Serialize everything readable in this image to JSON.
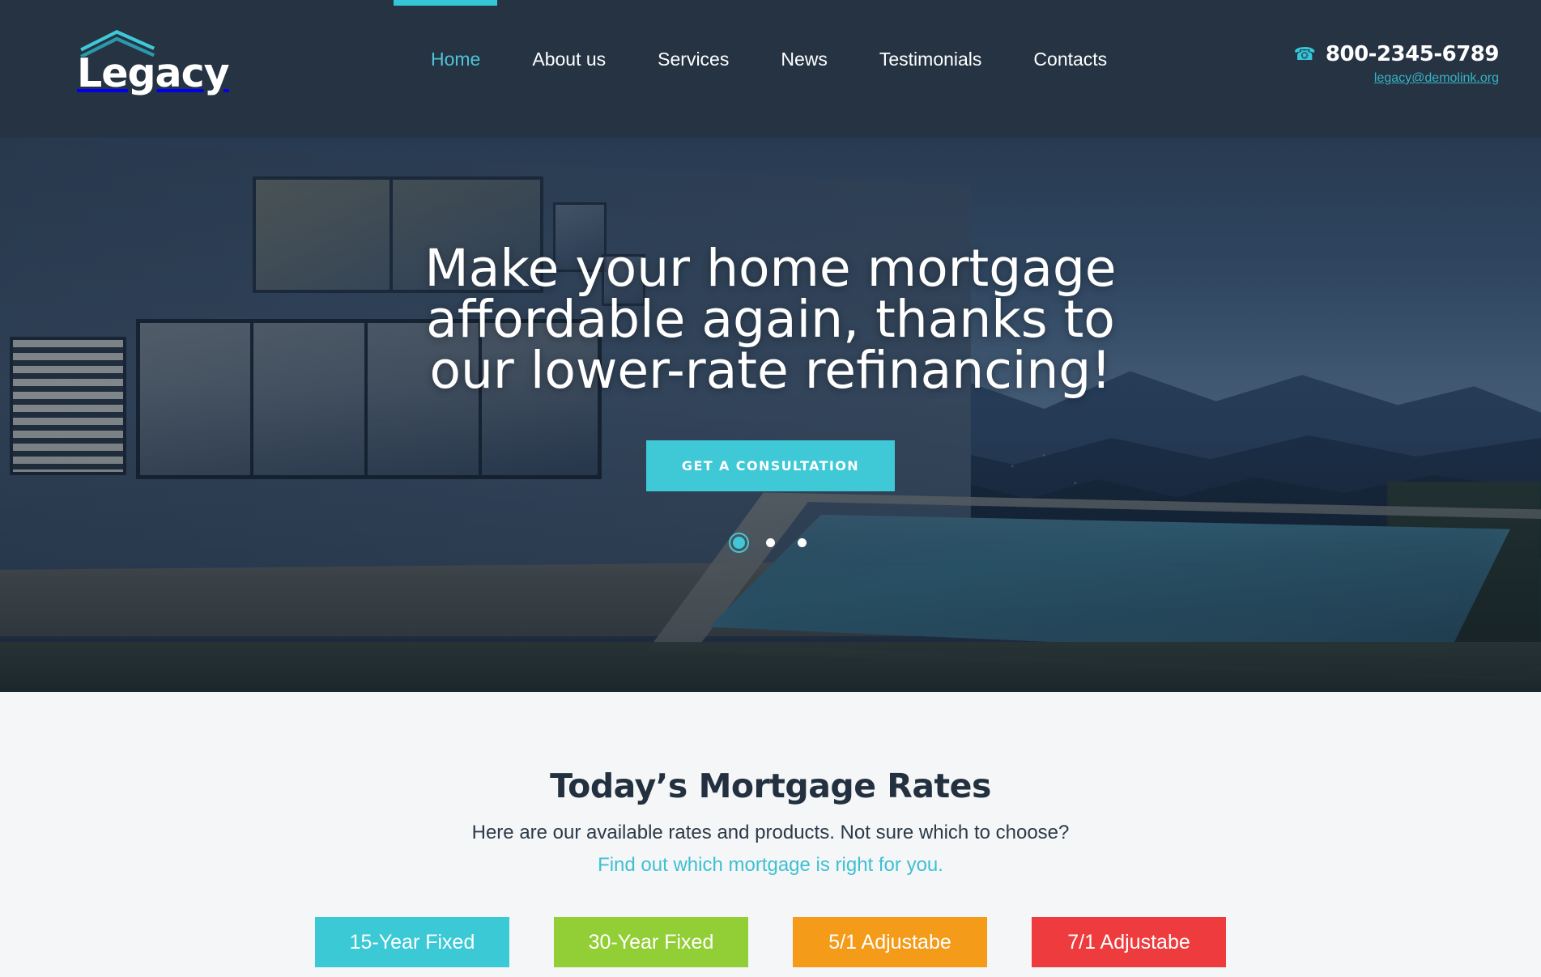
{
  "brand": {
    "name": "Legacy",
    "logo_icon": "roof-chevron-icon"
  },
  "nav": {
    "items": [
      {
        "label": "Home",
        "active": true
      },
      {
        "label": "About us",
        "active": false
      },
      {
        "label": "Services",
        "active": false
      },
      {
        "label": "News",
        "active": false
      },
      {
        "label": "Testimonials",
        "active": false
      },
      {
        "label": "Contacts",
        "active": false
      }
    ]
  },
  "contact": {
    "phone_icon": "phone-icon",
    "phone": "800-2345-6789",
    "email": "legacy@demolink.org"
  },
  "hero": {
    "title_line1": "Make your home mortgage",
    "title_line2": "affordable again, thanks to",
    "title_line3": "our lower-rate refinancing!",
    "cta_label": "GET A CONSULTATION",
    "slides_total": 3,
    "active_slide": 1
  },
  "rates": {
    "heading": "Today’s Mortgage Rates",
    "subheading": "Here are our available rates and products. Not sure which to choose?",
    "link_text": "Find out which mortgage is right for you.",
    "cards": [
      {
        "label": "15-Year Fixed",
        "color": "#3bc9d6"
      },
      {
        "label": "30-Year Fixed",
        "color": "#92ce35"
      },
      {
        "label": "5/1 Adjustabe",
        "color": "#f59b1a"
      },
      {
        "label": "7/1 Adjustabe",
        "color": "#ee3b3e"
      }
    ]
  },
  "colors": {
    "header_bg": "#253343",
    "accent": "#3fc8d6",
    "section_bg": "#f5f6f7",
    "heading": "#22303f"
  }
}
